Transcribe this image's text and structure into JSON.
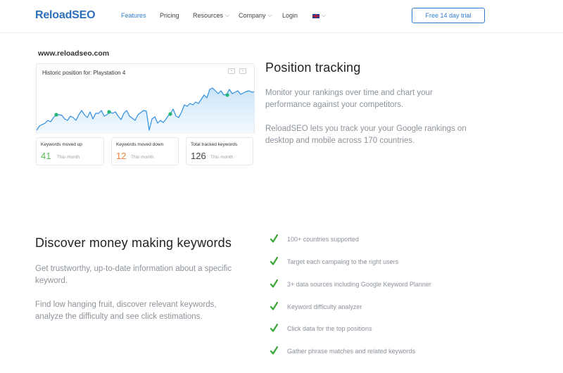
{
  "nav": {
    "logo": "ReloadSEO",
    "items": [
      {
        "label": "Features",
        "active": true
      },
      {
        "label": "Pricing"
      },
      {
        "label": "Resources",
        "dropdown": true
      },
      {
        "label": "Company",
        "dropdown": true
      },
      {
        "label": "Login"
      }
    ],
    "language_icon": "uk-flag-icon",
    "cta": "Free 14 day trial"
  },
  "tracking": {
    "site_url": "www.reloadseo.com",
    "chart": {
      "title": "Historic position for: Playstation 4",
      "line_color": "#2f8fe0",
      "marker_color": "#22b573"
    },
    "stats": [
      {
        "label": "Keywords moved up",
        "value": "41",
        "sub": "This month",
        "color": "#5cb85c"
      },
      {
        "label": "Keywords moved down",
        "value": "12",
        "sub": "This month",
        "color": "#f0843c"
      },
      {
        "label": "Total tracked keywords",
        "value": "126",
        "sub": "This month",
        "color": "#444444"
      }
    ],
    "heading": "Position tracking",
    "paragraph1": "Monitor your rankings over time and chart your performance against your competitors.",
    "paragraph2": "ReloadSEO lets you track your your Google rankings on desktop and mobile across 170 countries."
  },
  "keywords": {
    "heading": "Discover money making keywords",
    "paragraph1": "Get trustworthy, up-to-date information about a specific keyword.",
    "paragraph2": "Find low hanging fruit, discover relevant keywords, analyze the difficulty and see click estimations.",
    "check_color": "#3aa63a",
    "features": [
      "100+ countries supported",
      "Target each campaing to the right users",
      "3+ data sources including Google Keyword Planner",
      "Keyword difficulty analyzer",
      "Click data for the top positions",
      "Gather phrase matches and related keywords"
    ]
  }
}
